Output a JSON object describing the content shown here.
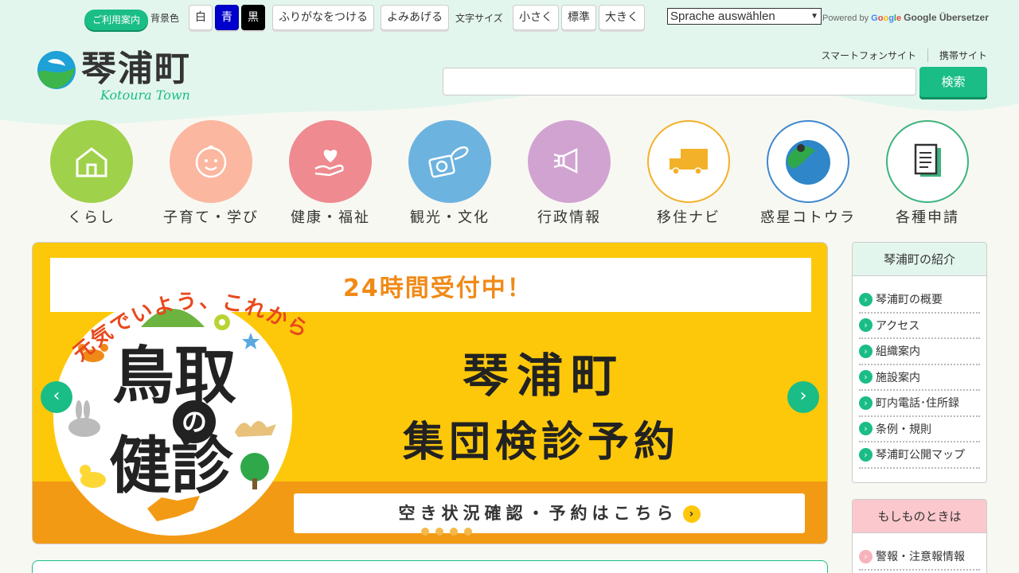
{
  "topbar": {
    "guide_label": "ご利用案内",
    "bg_color_label": "背景色",
    "bg_white": "白",
    "bg_blue": "青",
    "bg_black": "黒",
    "furigana_label": "ふりがなをつける",
    "readaloud_label": "よみあげる",
    "fontsize_label": "文字サイズ",
    "font_small": "小さく",
    "font_normal": "標準",
    "font_large": "大きく",
    "language_select": "Sprache auswählen",
    "powered_by": "Powered by",
    "translator": "Google Übersetzer"
  },
  "logo": {
    "title": "琴浦町",
    "subtitle": "Kotoura Town"
  },
  "header_links": {
    "smartphone": "スマートフォンサイト",
    "mobile": "携帯サイト"
  },
  "search": {
    "placeholder": "",
    "button_label": "検索"
  },
  "nav": [
    {
      "label": "くらし",
      "color": "#9fd14a"
    },
    {
      "label": "子育て・学び",
      "color": "#fbb7a0"
    },
    {
      "label": "健康・福祉",
      "color": "#ee8a90"
    },
    {
      "label": "観光・文化",
      "color": "#6db3e0"
    },
    {
      "label": "行政情報",
      "color": "#d1a3d1"
    },
    {
      "label": "移住ナビ",
      "color": "#f3b12a"
    },
    {
      "label": "惑星コトウラ",
      "color": "#3f88cf"
    },
    {
      "label": "各種申請",
      "color": "#3db37f"
    }
  ],
  "banner": {
    "arc_text": "元気でいよう、これからも",
    "open_24h": "24時間受付中！",
    "title": "琴浦町",
    "subtitle": "集団検診予約",
    "kanji_top": "鳥取",
    "kanji_no": "の",
    "kanji_bottom": "健診",
    "cta": "空き状況確認・予約はこちら",
    "prev_icon": "‹",
    "next_icon": "›"
  },
  "sidebar_intro": {
    "heading": "琴浦町の紹介",
    "items": [
      "琴浦町の概要",
      "アクセス",
      "組織案内",
      "施設案内",
      "町内電話･住所録",
      "条例・規則",
      "琴浦町公開マップ"
    ]
  },
  "sidebar_emergency": {
    "heading": "もしものときは",
    "items": [
      "警報・注意報情報"
    ]
  },
  "colors": {
    "accent": "#1bbd86",
    "banner_yellow": "#fdc80a",
    "banner_orange": "#f39a14",
    "emergency_pink": "#fbc8cd"
  }
}
